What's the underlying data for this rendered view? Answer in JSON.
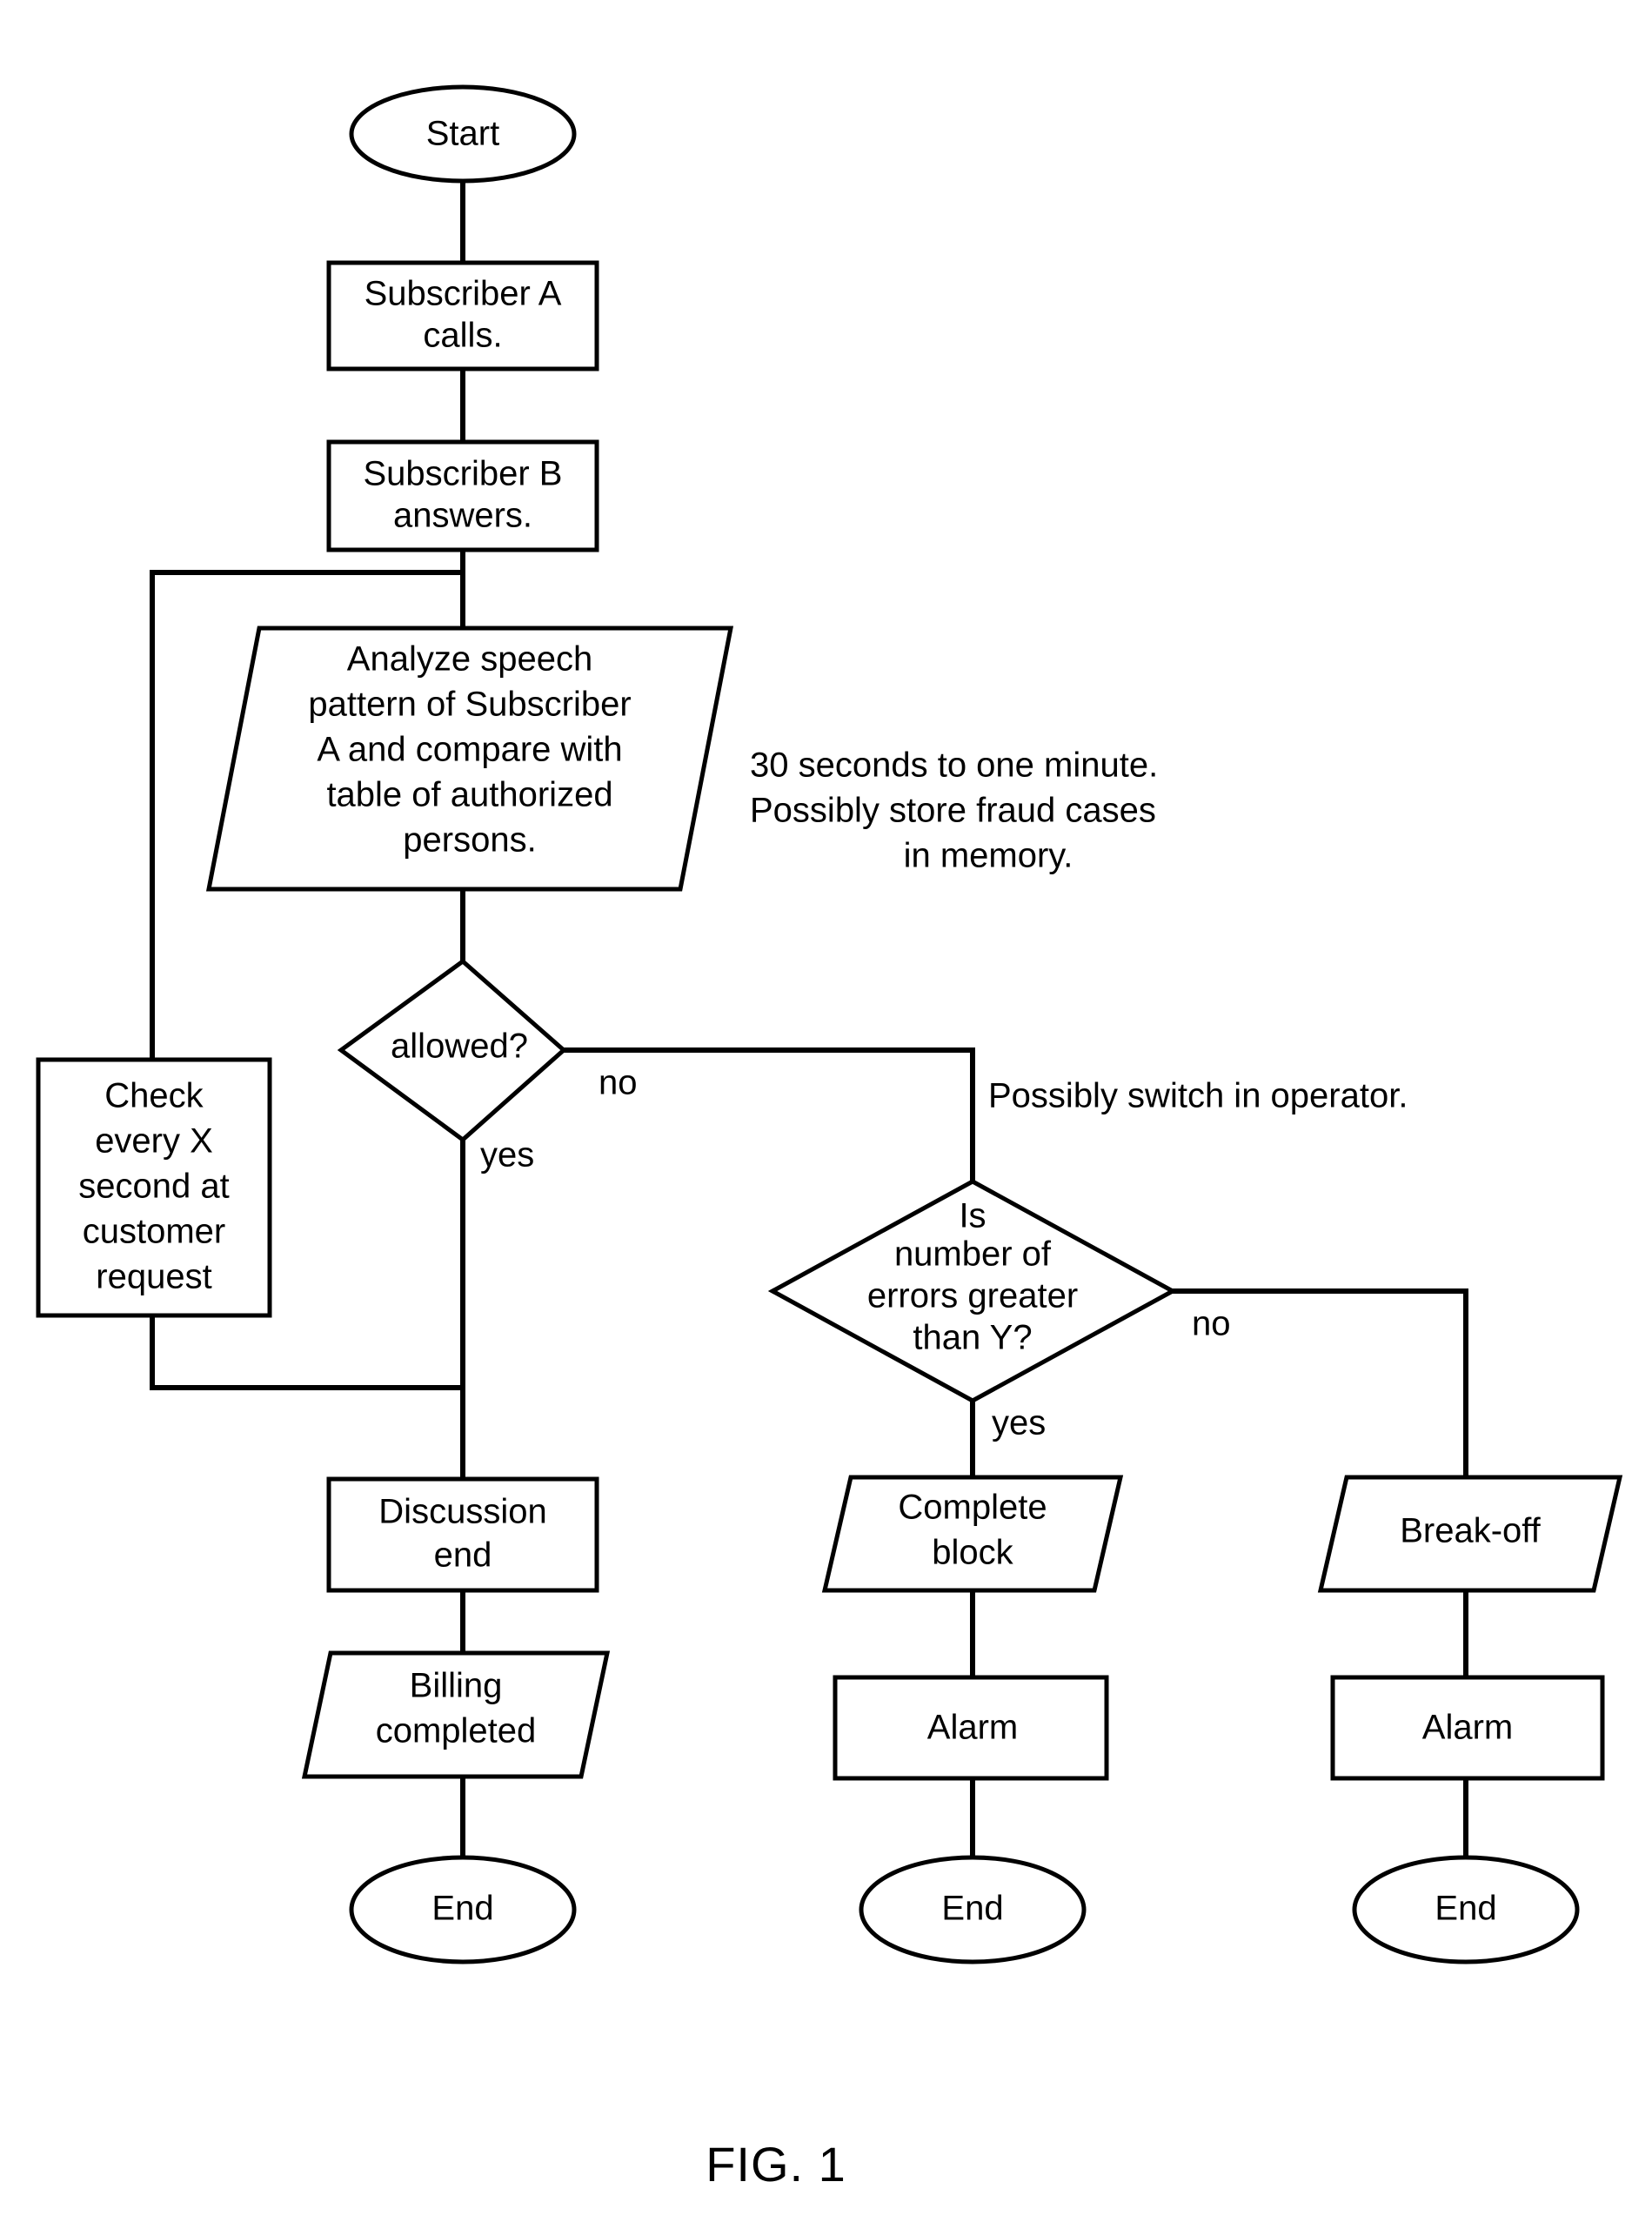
{
  "figure": {
    "caption": "FIG. 1"
  },
  "nodes": {
    "start": {
      "label": "Start",
      "shape": "ellipse"
    },
    "subscriber_a_calls": {
      "line1": "Subscriber A",
      "line2": "calls.",
      "shape": "rectangle"
    },
    "subscriber_b_answers": {
      "line1": "Subscriber B",
      "line2": "answers.",
      "shape": "rectangle"
    },
    "analyze_speech": {
      "line1": "Analyze speech",
      "line2": "pattern of Subscriber",
      "line3": "A and compare with",
      "line4": "table of authorized",
      "line5": "persons.",
      "shape": "parallelogram"
    },
    "allowed_decision": {
      "label": "allowed?",
      "shape": "diamond"
    },
    "check_every_x": {
      "line1": "Check",
      "line2": "every X",
      "line3": "second at",
      "line4": "customer",
      "line5": "request",
      "shape": "rectangle"
    },
    "errors_decision": {
      "line1": "Is",
      "line2": "number of",
      "line3": "errors greater",
      "line4": "than Y?",
      "shape": "diamond"
    },
    "discussion_end": {
      "line1": "Discussion",
      "line2": "end",
      "shape": "rectangle"
    },
    "billing_completed": {
      "line1": "Billing",
      "line2": "completed",
      "shape": "parallelogram"
    },
    "complete_block": {
      "line1": "Complete",
      "line2": "block",
      "shape": "parallelogram"
    },
    "break_off": {
      "label": "Break-off",
      "shape": "parallelogram"
    },
    "alarm_center": {
      "label": "Alarm",
      "shape": "rectangle"
    },
    "alarm_right": {
      "label": "Alarm",
      "shape": "rectangle"
    },
    "end_left": {
      "label": "End",
      "shape": "ellipse"
    },
    "end_center": {
      "label": "End",
      "shape": "ellipse"
    },
    "end_right": {
      "label": "End",
      "shape": "ellipse"
    }
  },
  "edge_labels": {
    "allowed_no": "no",
    "allowed_yes": "yes",
    "errors_no": "no",
    "errors_yes": "yes"
  },
  "annotations": {
    "timing": {
      "line1": "30 seconds to one minute.",
      "line2": "Possibly store fraud cases",
      "line3": "in memory."
    },
    "operator": {
      "line1": "Possibly switch in operator."
    }
  },
  "colors": {
    "stroke": "#000000",
    "fill": "#ffffff",
    "background": "#ffffff"
  }
}
